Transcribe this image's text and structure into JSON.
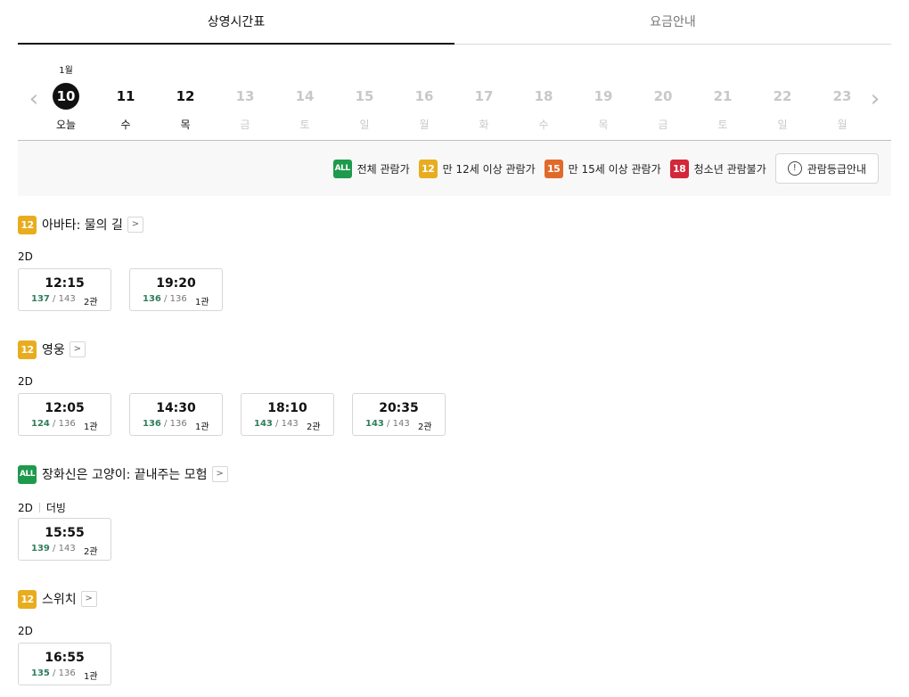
{
  "tabs": [
    {
      "label": "상영시간표",
      "active": true
    },
    {
      "label": "요금안내",
      "active": false
    }
  ],
  "dates": {
    "month_label": "1월",
    "days": [
      {
        "num": "10",
        "label": "오늘",
        "state": "selected"
      },
      {
        "num": "11",
        "label": "수",
        "state": "enabled"
      },
      {
        "num": "12",
        "label": "목",
        "state": "enabled"
      },
      {
        "num": "13",
        "label": "금",
        "state": "disabled"
      },
      {
        "num": "14",
        "label": "토",
        "state": "disabled"
      },
      {
        "num": "15",
        "label": "일",
        "state": "disabled"
      },
      {
        "num": "16",
        "label": "월",
        "state": "disabled"
      },
      {
        "num": "17",
        "label": "화",
        "state": "disabled"
      },
      {
        "num": "18",
        "label": "수",
        "state": "disabled"
      },
      {
        "num": "19",
        "label": "목",
        "state": "disabled"
      },
      {
        "num": "20",
        "label": "금",
        "state": "disabled"
      },
      {
        "num": "21",
        "label": "토",
        "state": "disabled"
      },
      {
        "num": "22",
        "label": "일",
        "state": "disabled"
      },
      {
        "num": "23",
        "label": "월",
        "state": "disabled"
      }
    ],
    "prev_icon": "chevron-left-icon",
    "next_icon": "chevron-right-icon"
  },
  "ratings_legend": {
    "items": [
      {
        "badge": "ALL",
        "label": "전체 관람가",
        "color": "#1f9a4c"
      },
      {
        "badge": "12",
        "label": "만 12세 이상 관람가",
        "color": "#e8ad1e"
      },
      {
        "badge": "15",
        "label": "만 15세 이상 관람가",
        "color": "#e06a2a"
      },
      {
        "badge": "18",
        "label": "청소년 관람불가",
        "color": "#d3273a"
      }
    ],
    "guide_button": "관람등급안내",
    "guide_icon": "!"
  },
  "movies": [
    {
      "rating": "12",
      "title": "아바타: 물의 길",
      "format": "2D",
      "sub_format": "",
      "showtimes": [
        {
          "time": "12:15",
          "remaining": "137",
          "total": "143",
          "hall": "2관"
        },
        {
          "time": "19:20",
          "remaining": "136",
          "total": "136",
          "hall": "1관"
        }
      ]
    },
    {
      "rating": "12",
      "title": "영웅",
      "format": "2D",
      "sub_format": "",
      "showtimes": [
        {
          "time": "12:05",
          "remaining": "124",
          "total": "136",
          "hall": "1관"
        },
        {
          "time": "14:30",
          "remaining": "136",
          "total": "136",
          "hall": "1관"
        },
        {
          "time": "18:10",
          "remaining": "143",
          "total": "143",
          "hall": "2관"
        },
        {
          "time": "20:35",
          "remaining": "143",
          "total": "143",
          "hall": "2관"
        }
      ]
    },
    {
      "rating": "ALL",
      "title": "장화신은 고양이: 끝내주는 모험",
      "format": "2D",
      "sub_format": "더빙",
      "showtimes": [
        {
          "time": "15:55",
          "remaining": "139",
          "total": "143",
          "hall": "2관"
        }
      ]
    },
    {
      "rating": "12",
      "title": "스위치",
      "format": "2D",
      "sub_format": "",
      "showtimes": [
        {
          "time": "16:55",
          "remaining": "135",
          "total": "136",
          "hall": "1관"
        }
      ]
    }
  ],
  "more_icon": ">",
  "seat_separator": " / "
}
